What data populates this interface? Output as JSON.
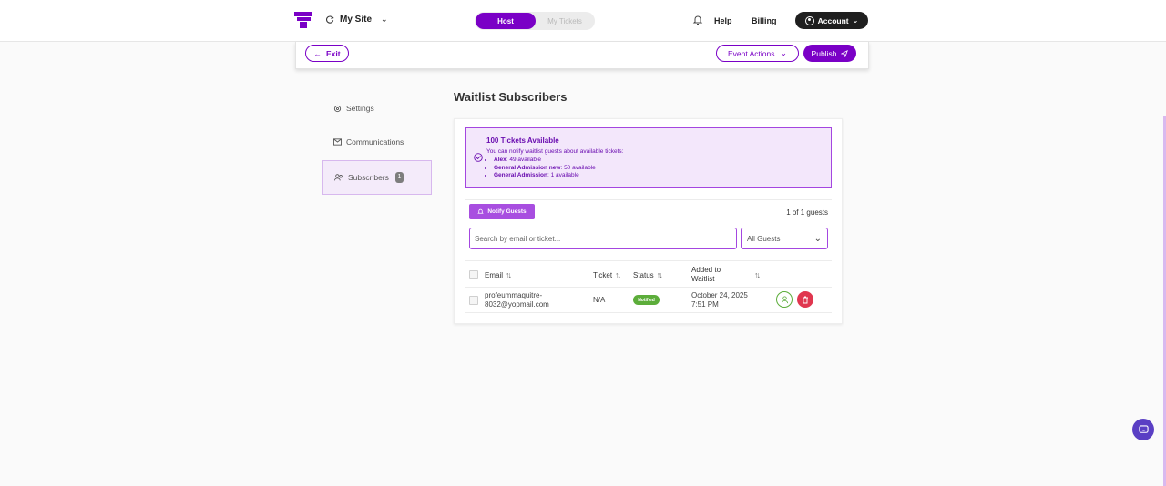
{
  "nav": {
    "site_name": "My Site",
    "toggle_active": "Host",
    "toggle_inactive": "My Tickets",
    "help": "Help",
    "billing": "Billing",
    "account": "Account"
  },
  "actionbar": {
    "exit": "Exit",
    "event_actions": "Event Actions",
    "publish": "Publish"
  },
  "sidebar": {
    "items": [
      {
        "label": "Settings",
        "icon": "gear-icon"
      },
      {
        "label": "Communications",
        "icon": "envelope-icon"
      },
      {
        "label": "Subscribers",
        "icon": "users-icon",
        "badge": "1",
        "active": true
      }
    ]
  },
  "main": {
    "title": "Waitlist Subscribers",
    "alert": {
      "title": "100 Tickets Available",
      "description": "You can notify waitlist guests about available tickets:",
      "items": [
        {
          "name": "Alex",
          "detail": ": 49 available"
        },
        {
          "name": "General Admission new",
          "detail": ": 50 available"
        },
        {
          "name": "General Admission",
          "detail": ": 1 available"
        }
      ]
    },
    "notify_button": "Notify Guests",
    "guest_count": "1 of 1 guests",
    "search_placeholder": "Search by email or ticket...",
    "filter_selected": "All Guests",
    "table": {
      "headers": {
        "email": "Email",
        "ticket": "Ticket",
        "status": "Status",
        "added_line1": "Added to",
        "added_line2": "Waitlist"
      },
      "rows": [
        {
          "email_line1": "profeummaquitre-",
          "email_line2": "8032@yopmail.com",
          "ticket": "N/A",
          "status": "Notified",
          "added_line1": "October 24, 2025",
          "added_line2": "7:51 PM"
        }
      ]
    }
  },
  "colors": {
    "brand": "#7a00c6",
    "alert_bg": "#f3e7fb",
    "status_green": "#5cad3a",
    "delete_red": "#e0364f"
  }
}
